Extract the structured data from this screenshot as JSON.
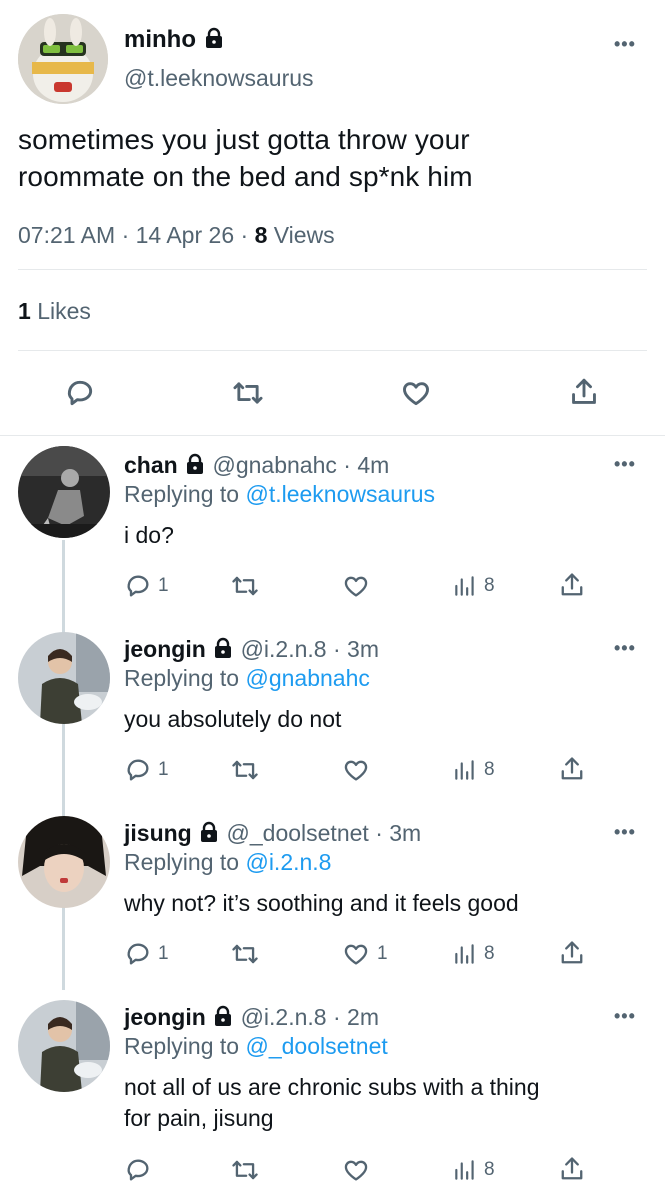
{
  "main_tweet": {
    "name": "minho",
    "handle": "@t.leeknowsaurus",
    "text_line1": "sometimes you just gotta throw your",
    "text_line2": "roommate on the bed and sp*nk him",
    "time": "07:21 AM",
    "sep1": "·",
    "date": "14 Apr 26",
    "sep2": "·",
    "views_count": "8",
    "views_label": "Views",
    "likes_count": "1",
    "likes_label": "Likes",
    "more": "•••"
  },
  "icons": {
    "lock": "lock-icon",
    "reply": "reply-icon",
    "retweet": "retweet-icon",
    "like": "heart-icon",
    "share": "share-icon",
    "views": "analytics-icon",
    "more": "more-icon"
  },
  "colors": {
    "link": "#1d9bf0",
    "muted": "#536471",
    "text": "#0f1419"
  },
  "replies": [
    {
      "name": "chan",
      "handle": "@gnabnahc",
      "sep": "·",
      "time": "4m",
      "replying_label": "Replying to",
      "replying_to": "@t.leeknowsaurus",
      "text_line1": "i do?",
      "text_line2": "",
      "reply_count": "1",
      "like_count": "",
      "views": "8",
      "more": "•••"
    },
    {
      "name": "jeongin",
      "handle": "@i.2.n.8",
      "sep": "·",
      "time": "3m",
      "replying_label": "Replying to",
      "replying_to": "@gnabnahc",
      "text_line1": "you absolutely do not",
      "text_line2": "",
      "reply_count": "1",
      "like_count": "",
      "views": "8",
      "more": "•••"
    },
    {
      "name": "jisung",
      "handle": "@_doolsetnet",
      "sep": "·",
      "time": "3m",
      "replying_label": "Replying to",
      "replying_to": "@i.2.n.8",
      "text_line1": "why not? it’s soothing and it feels good",
      "text_line2": "",
      "reply_count": "1",
      "like_count": "1",
      "views": "8",
      "more": "•••"
    },
    {
      "name": "jeongin",
      "handle": "@i.2.n.8",
      "sep": "·",
      "time": "2m",
      "replying_label": "Replying to",
      "replying_to": "@_doolsetnet",
      "text_line1": "not all of us are chronic subs with a thing",
      "text_line2": "for pain, jisung",
      "reply_count": "",
      "like_count": "",
      "views": "8",
      "more": "•••"
    }
  ]
}
